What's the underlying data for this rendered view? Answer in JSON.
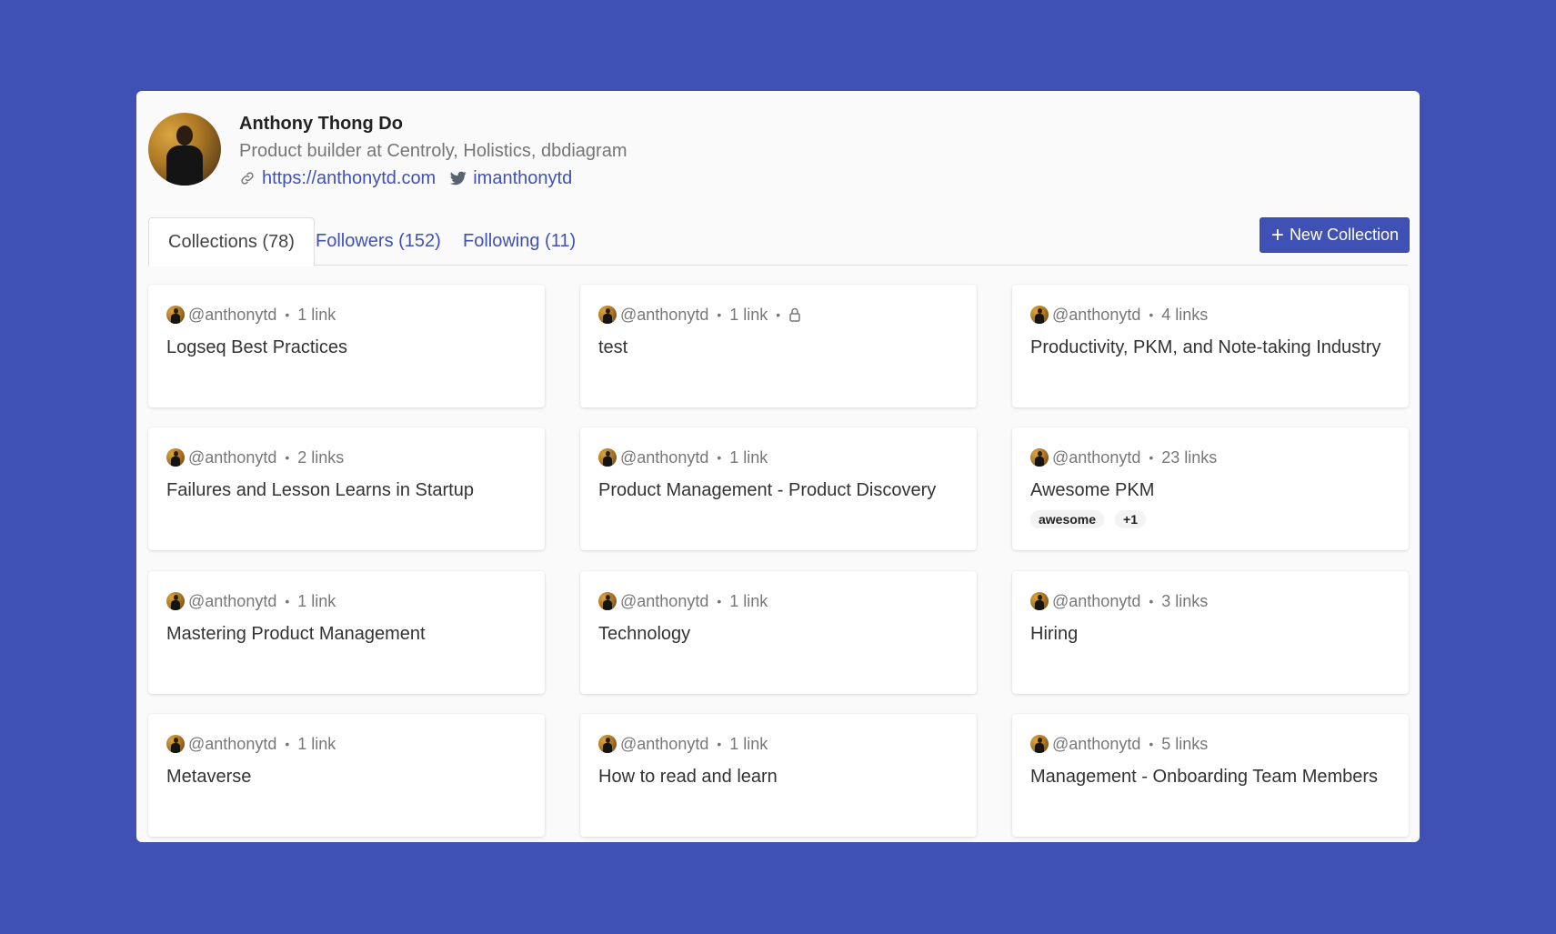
{
  "profile": {
    "name": "Anthony Thong Do",
    "bio": "Product builder at Centroly, Holistics, dbdiagram",
    "website": "https://anthonytd.com",
    "twitter": "imanthonytd"
  },
  "tabs": [
    {
      "label": "Collections (78)",
      "active": true
    },
    {
      "label": "Followers (152)",
      "active": false
    },
    {
      "label": "Following (11)",
      "active": false
    }
  ],
  "new_collection": {
    "plus": "+",
    "label": "New Collection"
  },
  "colors": {
    "accent": "#3f51b5",
    "background": "#3f51b5",
    "panel": "#fafafa"
  },
  "separator": "•",
  "cards": [
    {
      "user": "@anthonytd",
      "links": "1 link",
      "title": "Logseq Best Practices",
      "locked": false,
      "tags": []
    },
    {
      "user": "@anthonytd",
      "links": "1 link",
      "title": "test",
      "locked": true,
      "tags": []
    },
    {
      "user": "@anthonytd",
      "links": "4 links",
      "title": "Productivity, PKM, and Note-taking Industry",
      "locked": false,
      "tags": []
    },
    {
      "user": "@anthonytd",
      "links": "2 links",
      "title": "Failures and Lesson Learns in Startup",
      "locked": false,
      "tags": []
    },
    {
      "user": "@anthonytd",
      "links": "1 link",
      "title": "Product Management - Product Discovery",
      "locked": false,
      "tags": []
    },
    {
      "user": "@anthonytd",
      "links": "23 links",
      "title": "Awesome PKM",
      "locked": false,
      "tags": [
        "awesome",
        "+1"
      ]
    },
    {
      "user": "@anthonytd",
      "links": "1 link",
      "title": "Mastering Product Management",
      "locked": false,
      "tags": []
    },
    {
      "user": "@anthonytd",
      "links": "1 link",
      "title": "Technology",
      "locked": false,
      "tags": []
    },
    {
      "user": "@anthonytd",
      "links": "3 links",
      "title": "Hiring",
      "locked": false,
      "tags": []
    },
    {
      "user": "@anthonytd",
      "links": "1 link",
      "title": "Metaverse",
      "locked": false,
      "tags": []
    },
    {
      "user": "@anthonytd",
      "links": "1 link",
      "title": "How to read and learn",
      "locked": false,
      "tags": []
    },
    {
      "user": "@anthonytd",
      "links": "5 links",
      "title": "Management - Onboarding Team Members",
      "locked": false,
      "tags": []
    }
  ]
}
